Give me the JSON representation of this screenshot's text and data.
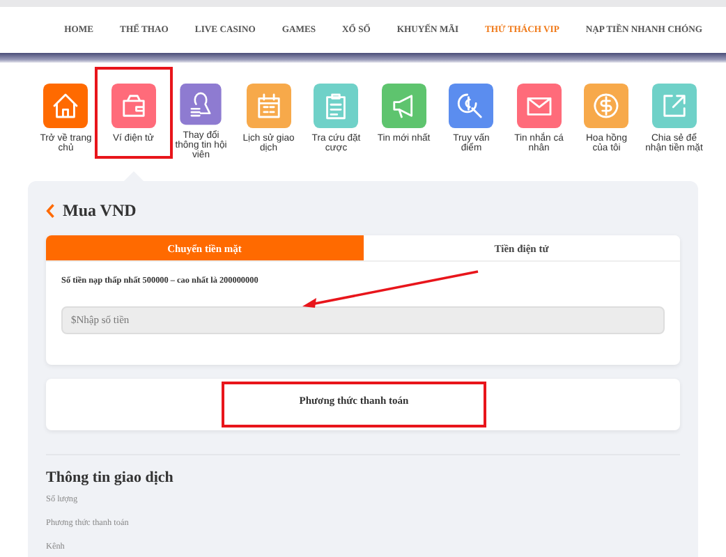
{
  "nav": [
    {
      "label": "HOME",
      "selected": false
    },
    {
      "label": "THỂ THAO",
      "selected": false
    },
    {
      "label": "LIVE CASINO",
      "selected": false
    },
    {
      "label": "GAMES",
      "selected": false
    },
    {
      "label": "XỔ SỐ",
      "selected": false
    },
    {
      "label": "KHUYẾN MÃI",
      "selected": false
    },
    {
      "label": "THỬ THÁCH VIP",
      "selected": true
    },
    {
      "label": "NẠP TIỀN NHANH CHÓNG",
      "selected": false
    }
  ],
  "shortcuts": [
    {
      "kind": "home",
      "label": "Trở về trang chủ",
      "color": "#ff6a00",
      "selected": false,
      "highlighted": false
    },
    {
      "kind": "wallet",
      "label": "Ví điện tử",
      "color": "#ff6b7a",
      "selected": true,
      "highlighted": true
    },
    {
      "kind": "member",
      "label": "Thay đổi thông tin hội viên",
      "color": "#8e7bd1",
      "selected": false,
      "highlighted": false
    },
    {
      "kind": "calendar",
      "label": "Lịch sử giao dịch",
      "color": "#f7a94a",
      "selected": false,
      "highlighted": false
    },
    {
      "kind": "clipboard",
      "label": "Tra cứu đặt cược",
      "color": "#6fd1c8",
      "selected": false,
      "highlighted": false
    },
    {
      "kind": "megaphone",
      "label": "Tin mới nhất",
      "color": "#5ec46e",
      "selected": false,
      "highlighted": false
    },
    {
      "kind": "search-coin",
      "label": "Truy vấn điểm",
      "color": "#5b8def",
      "selected": false,
      "highlighted": false
    },
    {
      "kind": "mail",
      "label": "Tin nhắn cá nhân",
      "color": "#ff6b7a",
      "selected": false,
      "highlighted": false
    },
    {
      "kind": "coin",
      "label": "Hoa hồng của tôi",
      "color": "#f7a94a",
      "selected": false,
      "highlighted": false
    },
    {
      "kind": "share",
      "label": "Chia sẻ để nhận tiền mặt",
      "color": "#6fd1c8",
      "selected": false,
      "highlighted": false
    }
  ],
  "panel": {
    "title": "Mua VND",
    "tabs": [
      {
        "label": "Chuyển tiền mặt",
        "selected": true
      },
      {
        "label": "Tiền điện tử",
        "selected": false
      }
    ],
    "hint": "Số tiền nạp thấp nhất 500000 – cao nhất là 200000000",
    "amount_field": {
      "placeholder": "$Nhập số tiền"
    },
    "payment_method": {
      "label": "Phương thức thanh toán",
      "highlighted": true
    },
    "transaction_info": {
      "title": "Thông tin giao dịch",
      "fields": [
        "Số lượng",
        "Phương thức thanh toán",
        "Kênh"
      ]
    }
  }
}
